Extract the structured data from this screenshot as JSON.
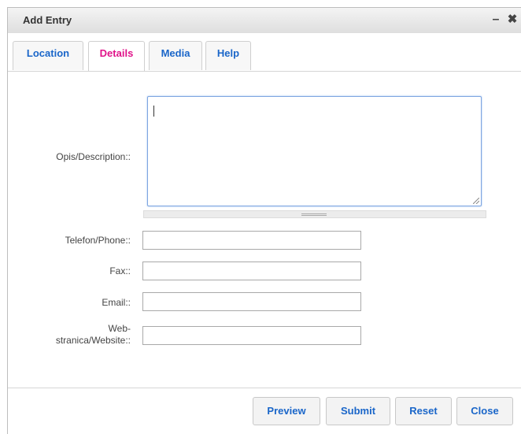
{
  "dialog": {
    "title": "Add Entry",
    "minimize_icon": "minimize-icon",
    "close_icon": "close-icon"
  },
  "tabs": [
    {
      "label": "Location",
      "active": false
    },
    {
      "label": "Details",
      "active": true
    },
    {
      "label": "Media",
      "active": false
    },
    {
      "label": "Help",
      "active": false
    }
  ],
  "form": {
    "description_label": "Opis/Description::",
    "description_value": "",
    "phone_label": "Telefon/Phone::",
    "phone_value": "",
    "fax_label": "Fax::",
    "fax_value": "",
    "email_label": "Email::",
    "email_value": "",
    "website_label_line1": "Web-",
    "website_label_line2": "stranica/Website::",
    "website_value": ""
  },
  "buttons": {
    "preview": "Preview",
    "submit": "Submit",
    "reset": "Reset",
    "close": "Close"
  },
  "colors": {
    "tab_link": "#1a66c9",
    "tab_active": "#e0148a",
    "textarea_focus_border": "#7da5e0"
  }
}
